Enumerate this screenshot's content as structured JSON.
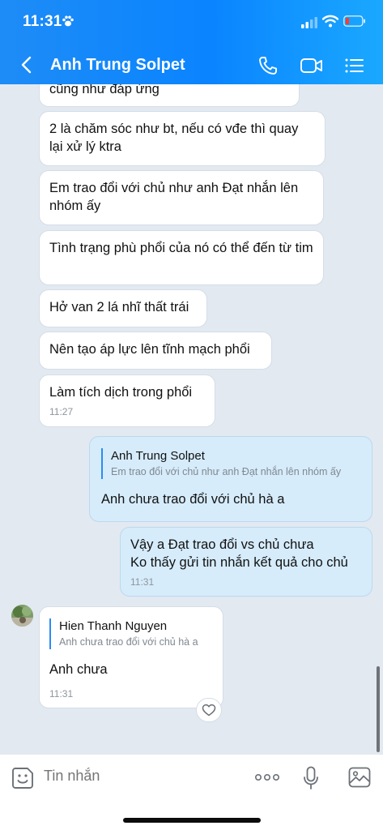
{
  "status_bar": {
    "time": "11:31"
  },
  "header": {
    "title": "Anh Trung Solpet"
  },
  "messages": {
    "m0": {
      "text": "cũng như đáp ứng"
    },
    "m1": {
      "text": "2 là chăm sóc như bt, nếu có vđe thì quay lại xử lý ktra"
    },
    "m2": {
      "text": "Em trao đổi với chủ như anh Đạt nhắn lên nhóm ấy"
    },
    "m3": {
      "text": "Tình trạng phù phổi của nó có thể đến từ tim"
    },
    "m4": {
      "text": "Hở van 2 lá nhĩ thất trái"
    },
    "m5": {
      "text": "Nên tạo áp lực lên tĩnh mạch phổi"
    },
    "m6": {
      "text": "Làm tích dịch trong phổi",
      "time": "11:27"
    },
    "m7": {
      "quote_name": "Anh Trung Solpet",
      "quote_text": "Em trao đổi với chủ như anh Đạt nhắn lên nhóm ấy",
      "text": "Anh chưa trao đổi với chủ hà a"
    },
    "m8": {
      "line1": "Vậy a Đạt trao đổi vs chủ chưa",
      "line2": "Ko thấy gửi tin nhắn kết quả cho chủ",
      "time": "11:31"
    },
    "m9": {
      "quote_name": "Hien Thanh Nguyen",
      "quote_text": "Anh chưa trao đổi với chủ hà a",
      "text": "Anh chưa",
      "time": "11:31"
    }
  },
  "composer": {
    "placeholder": "Tin nhắn"
  },
  "colors": {
    "header": "#0a84ff",
    "chat_bg": "#e2e9f1",
    "my_bubble": "#d6ecfb",
    "their_bubble": "#ffffff",
    "quote_bar": "#2b8cf4"
  }
}
